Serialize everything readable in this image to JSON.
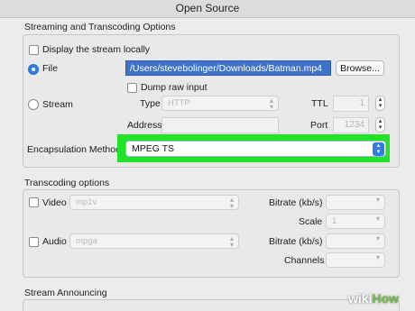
{
  "window": {
    "title": "Open Source"
  },
  "streaming": {
    "section_title": "Streaming and Transcoding Options",
    "display_locally_label": "Display the stream locally",
    "file_label": "File",
    "file_path": "/Users/stevebolinger/Downloads/Batman.mp4",
    "browse_label": "Browse...",
    "dump_raw_label": "Dump raw input",
    "stream_label": "Stream",
    "type_label": "Type",
    "type_value": "HTTP",
    "ttl_label": "TTL",
    "ttl_value": "1",
    "address_label": "Address",
    "address_value": "",
    "port_label": "Port",
    "port_value": "1234",
    "encapsulation_label": "Encapsulation Method",
    "encapsulation_value": "MPEG TS"
  },
  "transcoding": {
    "section_title": "Transcoding options",
    "video_label": "Video",
    "video_codec": "mp1v",
    "audio_label": "Audio",
    "audio_codec": "mpga",
    "video_bitrate_label": "Bitrate (kb/s)",
    "scale_label": "Scale",
    "scale_value": "1",
    "audio_bitrate_label": "Bitrate (kb/s)",
    "channels_label": "Channels"
  },
  "announcing": {
    "section_title": "Stream Announcing"
  },
  "watermark": {
    "prefix": "wiki",
    "suffix": "How"
  },
  "colors": {
    "highlight": "#21e32a",
    "accent": "#2f7de1"
  }
}
